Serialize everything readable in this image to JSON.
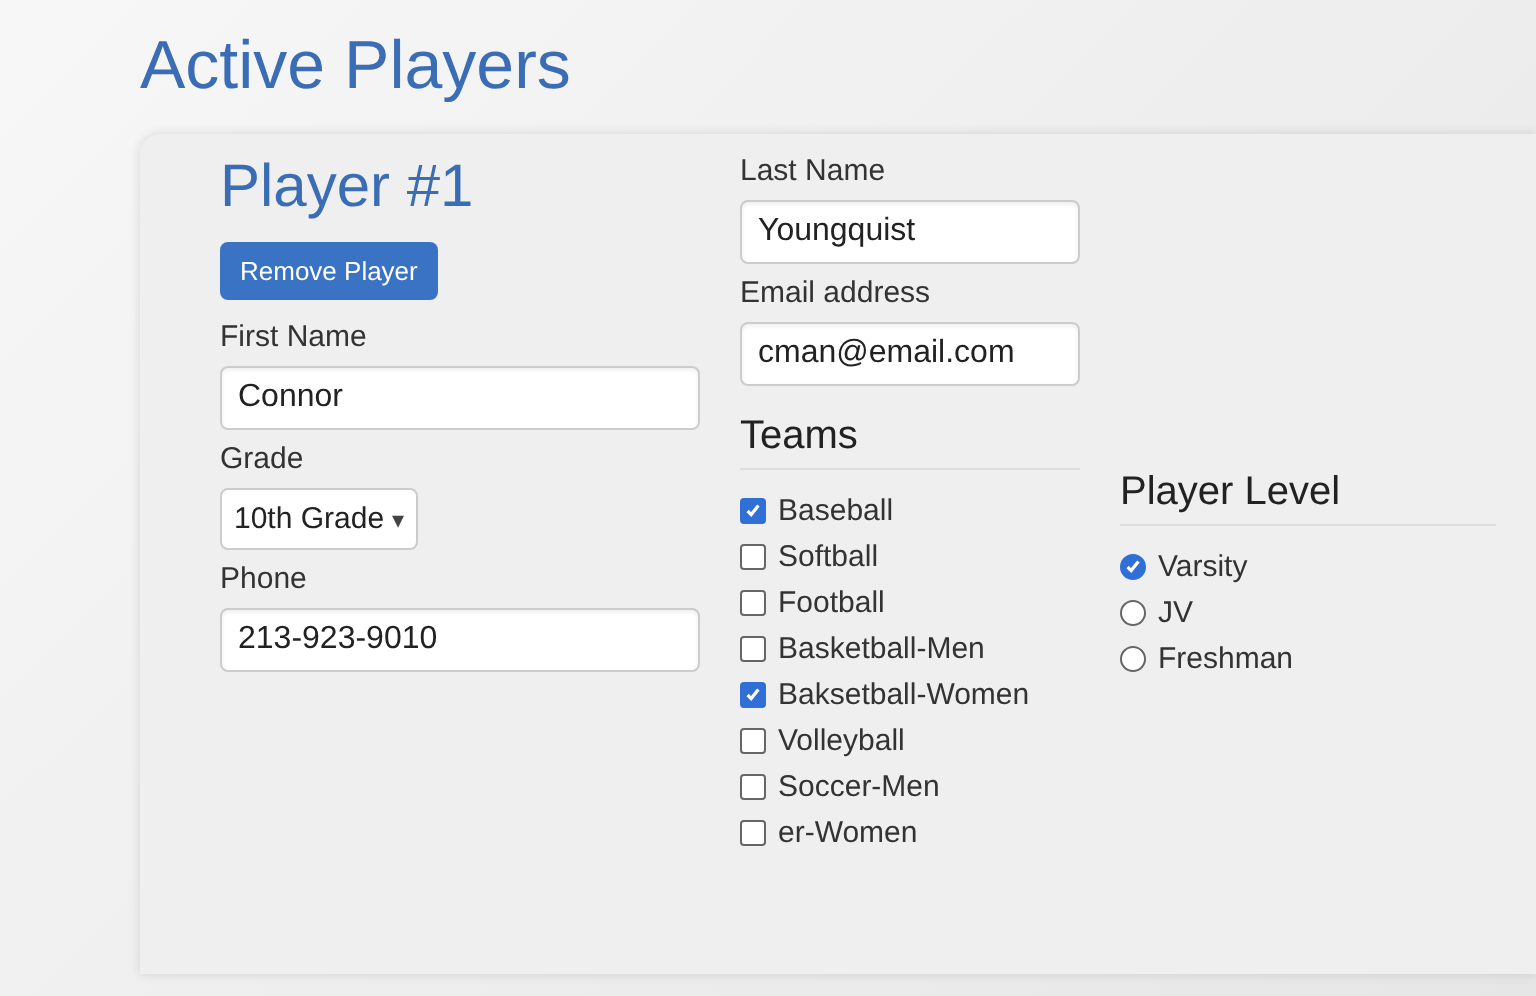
{
  "page_title": "Active Players",
  "player": {
    "title": "Player #1",
    "remove_button": "Remove Player",
    "fields": {
      "first_name": {
        "label": "First Name",
        "value": "Connor"
      },
      "last_name": {
        "label": "Last Name",
        "value": "Youngquist"
      },
      "grade": {
        "label": "Grade",
        "value": "10th Grade",
        "caret": "▾"
      },
      "email": {
        "label": "Email address",
        "value": "cman@email.com"
      },
      "phone": {
        "label": "Phone",
        "value": "213-923-9010"
      }
    },
    "teams": {
      "heading": "Teams",
      "items": [
        {
          "label": "Baseball",
          "checked": true
        },
        {
          "label": "Softball",
          "checked": false
        },
        {
          "label": "Football",
          "checked": false
        },
        {
          "label": "Basketball-Men",
          "checked": false
        },
        {
          "label": "Baksetball-Women",
          "checked": true
        },
        {
          "label": "Volleyball",
          "checked": false
        },
        {
          "label": "Soccer-Men",
          "checked": false
        },
        {
          "label": "er-Women",
          "checked": false
        }
      ]
    },
    "player_level": {
      "heading": "Player Level",
      "options": [
        {
          "label": "Varsity",
          "selected": true
        },
        {
          "label": "JV",
          "selected": false
        },
        {
          "label": "Freshman",
          "selected": false
        }
      ]
    }
  }
}
